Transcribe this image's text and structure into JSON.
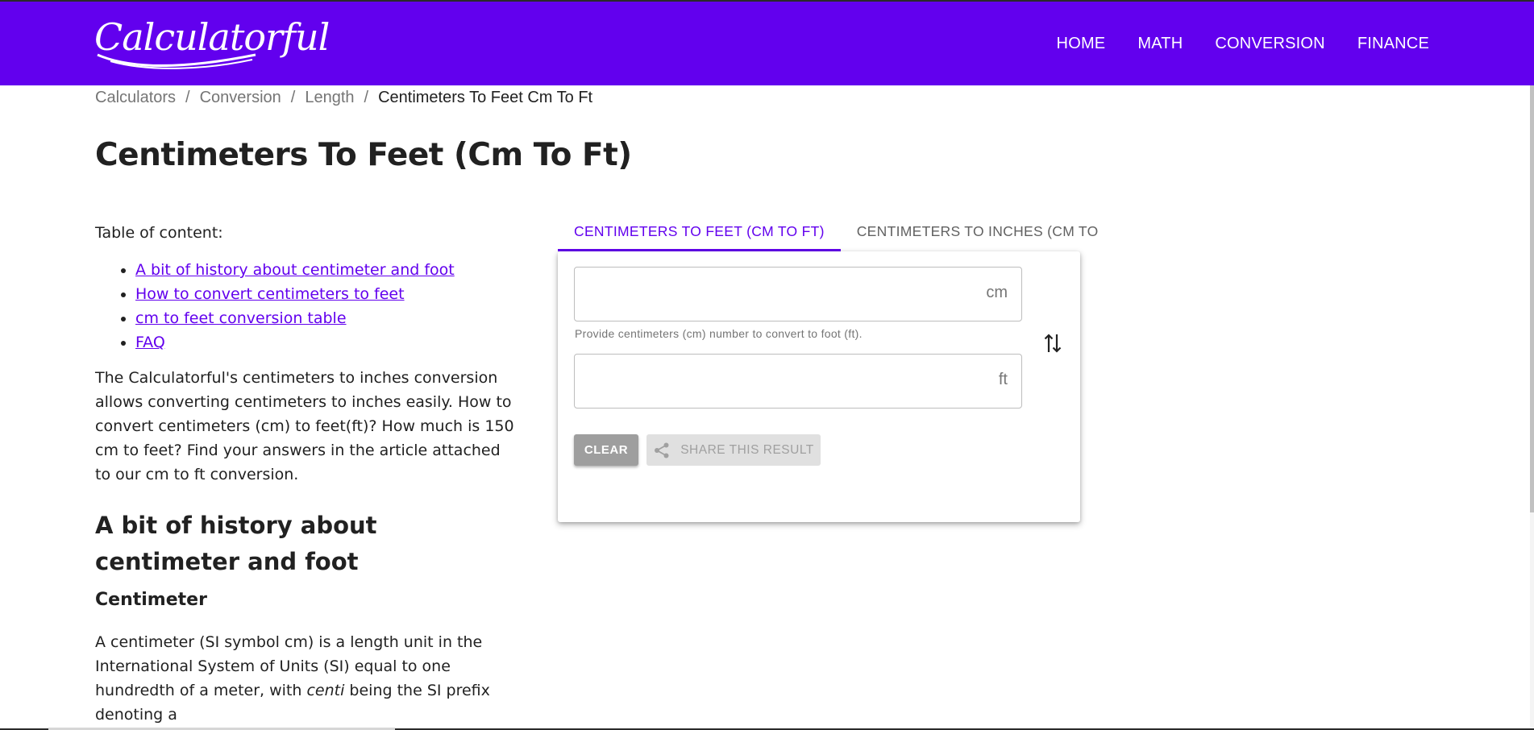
{
  "brand": {
    "logo_text": "Calculatorful",
    "primary_color": "#6200ee"
  },
  "nav": {
    "items": [
      "HOME",
      "MATH",
      "CONVERSION",
      "FINANCE"
    ]
  },
  "breadcrumb": {
    "items": [
      "Calculators",
      "Conversion",
      "Length"
    ],
    "current": "Centimeters To Feet Cm To Ft",
    "separator": "/"
  },
  "page": {
    "title": "Centimeters To Feet (Cm To Ft)"
  },
  "toc": {
    "title": "Table of content:",
    "items": [
      "A bit of history about centimeter and foot",
      "How to convert centimeters to feet",
      "cm to feet conversion table",
      "FAQ"
    ]
  },
  "intro": "The Calculatorful's centimeters to inches conversion allows converting centimeters to inches easily. How to convert centimeters (cm) to feet(ft)? How much is 150 cm to feet? Find your answers in the article attached to our cm to ft conversion.",
  "section": {
    "title": "A bit of history about centimeter and foot",
    "sub_title": "Centimeter",
    "para_start": "A centimeter (SI symbol cm) is a length unit in the International System of Units (SI) equal to one hundredth of a meter, with ",
    "para_em": "centi",
    "para_end": " being the SI prefix denoting a"
  },
  "converter": {
    "tabs": [
      "CENTIMETERS TO FEET (CM TO FT)",
      "CENTIMETERS TO INCHES (CM TO"
    ],
    "input_cm": {
      "value": "",
      "suffix": "cm",
      "hint": "Provide centimeters (cm) number to convert to foot (ft)."
    },
    "input_ft": {
      "value": "",
      "suffix": "ft"
    },
    "clear_label": "CLEAR",
    "share_label": "SHARE THIS RESULT"
  }
}
